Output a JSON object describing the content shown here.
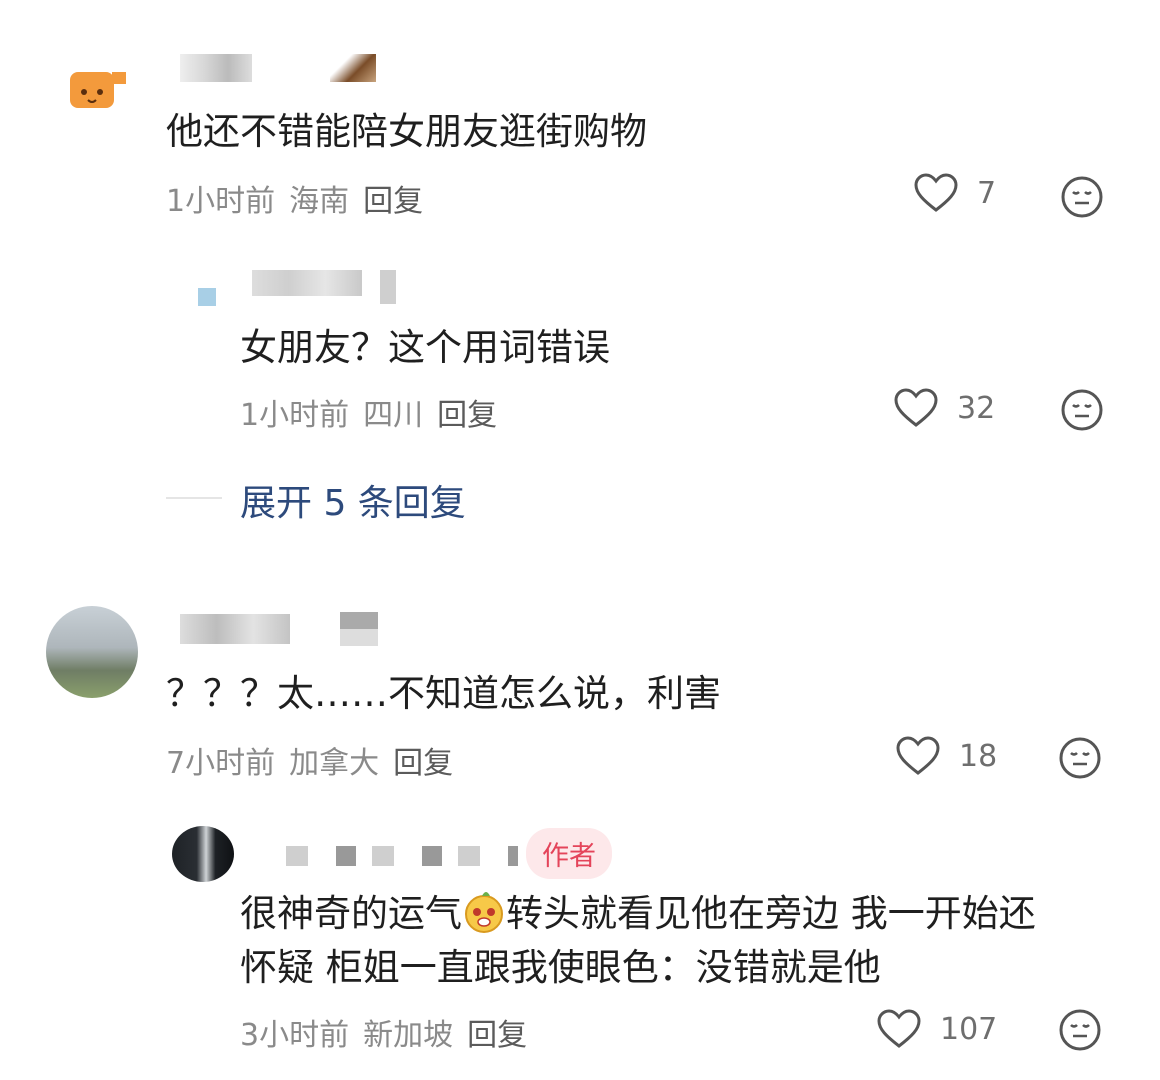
{
  "comments": [
    {
      "text": "他还不错能陪女朋友逛街购物",
      "time": "1小时前",
      "location": "海南",
      "reply_label": "回复",
      "likes": "7",
      "replies": [
        {
          "text": "女朋友？这个用词错误",
          "time": "1小时前",
          "location": "四川",
          "reply_label": "回复",
          "likes": "32"
        }
      ],
      "expand_label": "展开 5 条回复"
    },
    {
      "text": "？？？太……不知道怎么说，利害",
      "time": "7小时前",
      "location": "加拿大",
      "reply_label": "回复",
      "likes": "18",
      "replies": [
        {
          "author_tag": "作者",
          "text_line1_a": "很神奇的运气",
          "text_line1_b": "转头就看见他在旁边 我一开始还",
          "text_line2": "怀疑 柜姐一直跟我使眼色：没错就是他",
          "time": "3小时前",
          "location": "新加坡",
          "reply_label": "回复",
          "likes": "107"
        }
      ]
    }
  ],
  "colors": {
    "meta_gray": "#8a8a8a",
    "link_blue": "#2d4a7c",
    "author_tag_bg": "#fde8ea",
    "author_tag_fg": "#e4445a"
  },
  "icons": [
    "heart-outline-icon",
    "dislike-face-icon",
    "emoji-face-icon"
  ]
}
